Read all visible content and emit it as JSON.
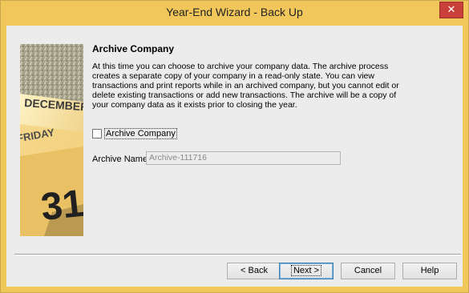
{
  "window": {
    "title": "Year-End Wizard - Back Up",
    "close_glyph": "✕"
  },
  "image": {
    "icon": "calendar-photo",
    "month": "DECEMBER",
    "weekday": "FRIDAY",
    "day": "31"
  },
  "content": {
    "heading": "Archive Company",
    "description": "At this time you can choose to archive your company data.  The archive process creates a separate copy of your company in a read-only state.  You can view transactions and print reports while in an archived company, but you cannot edit or delete existing transactions or add new transactions.  The archive will be a copy of your company data as it exists prior to closing the year.",
    "checkbox_label": "Archive Company",
    "checkbox_checked": false,
    "archive_name_label": "Archive Name:",
    "archive_name_value": "Archive-111716"
  },
  "buttons": {
    "back": "< Back",
    "next": "Next >",
    "cancel": "Cancel",
    "help": "Help"
  }
}
